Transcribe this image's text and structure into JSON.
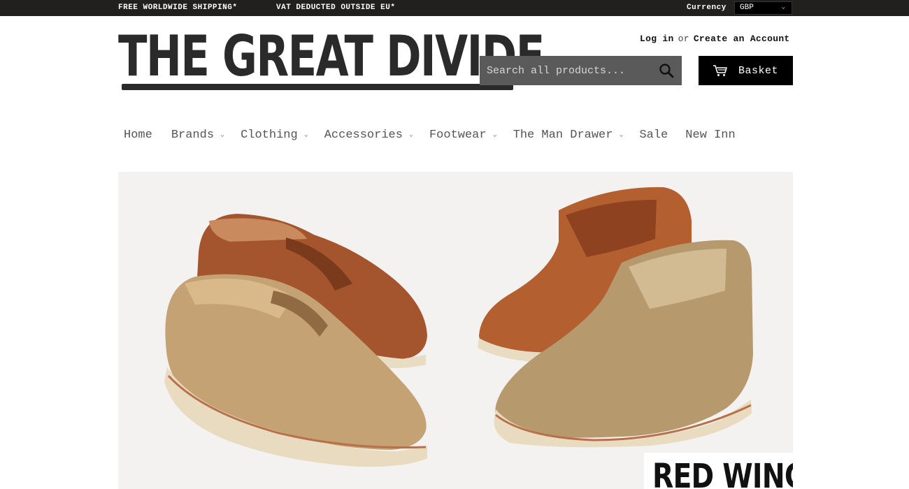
{
  "topbar": {
    "promo_1": "FREE WORLDWIDE SHIPPING*",
    "promo_2": "VAT DEDUCTED OUTSIDE EU*",
    "currency_label": "Currency",
    "currency_value": "GBP"
  },
  "header": {
    "logo_text": "THE GREAT DIVIDE",
    "login": "Log in",
    "or": "or",
    "create_account": "Create an Account",
    "search_placeholder": "Search all products...",
    "basket_label": "Basket"
  },
  "nav": {
    "items": [
      {
        "label": "Home",
        "has_dropdown": false
      },
      {
        "label": "Brands",
        "has_dropdown": true
      },
      {
        "label": "Clothing",
        "has_dropdown": true
      },
      {
        "label": "Accessories",
        "has_dropdown": true
      },
      {
        "label": "Footwear",
        "has_dropdown": true
      },
      {
        "label": "The Man Drawer",
        "has_dropdown": true
      },
      {
        "label": "Sale",
        "has_dropdown": false
      },
      {
        "label": "New Inn",
        "has_dropdown": false
      }
    ]
  },
  "hero": {
    "brand_label": "RED WING"
  },
  "icons": {
    "search": "search-icon",
    "cart": "cart-icon",
    "dropdown": "chevron-down-icon"
  },
  "colors": {
    "topbar_bg": "#221f1f",
    "search_bg": "#5a5a5a",
    "basket_bg": "#000000",
    "hero_bg": "#f3f2f0"
  }
}
